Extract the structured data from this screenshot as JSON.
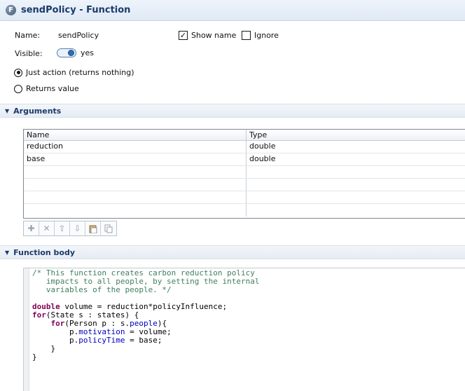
{
  "header": {
    "icon_letter": "F",
    "title": "sendPolicy - Function"
  },
  "properties": {
    "name_label": "Name:",
    "name_value": "sendPolicy",
    "show_name_label": "Show name",
    "show_name_checked": "✓",
    "ignore_label": "Ignore",
    "visible_label": "Visible:",
    "visible_value": "yes",
    "radio_just_action": "Just action (returns nothing)",
    "radio_returns_value": "Returns value"
  },
  "arguments": {
    "section_title": "Arguments",
    "columns": [
      "Name",
      "Type"
    ],
    "rows": [
      {
        "name": "reduction",
        "type": "double"
      },
      {
        "name": "base",
        "type": "double"
      }
    ]
  },
  "function_body": {
    "section_title": "Function body",
    "code_lines": [
      "/* This function creates carbon reduction policy",
      "   impacts to all people, by setting the internal",
      "   variables of the people. */",
      "",
      "double volume = reduction*policyInfluence;",
      "for(State s : states) {",
      "    for(Person p : s.people){",
      "        p.motivation = volume;",
      "        p.policyTime = base;",
      "    }",
      "}"
    ]
  },
  "colors": {
    "title_text": "#1b3a6b",
    "comment": "#3f7f5f",
    "keyword": "#7f0055",
    "field": "#0000c0"
  },
  "icons": [
    "function-icon",
    "add-icon",
    "delete-icon",
    "move-up-icon",
    "move-down-icon",
    "paste-icon",
    "copy-icon"
  ]
}
